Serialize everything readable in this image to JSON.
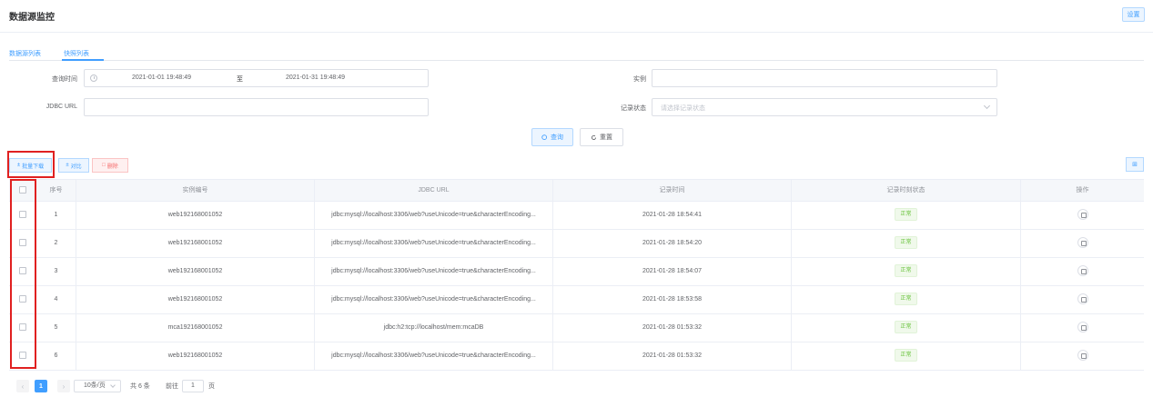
{
  "header": {
    "title": "数据源监控",
    "settings_label": "设置"
  },
  "tabs": [
    {
      "label": "数据源列表",
      "active": false
    },
    {
      "label": "快照列表",
      "active": true
    }
  ],
  "filters": {
    "query_time_label": "查询时间",
    "start_time": "2021-01-01 19:48:49",
    "range_separator": "至",
    "end_time": "2021-01-31 19:48:49",
    "instance_label": "实例",
    "instance_value": "",
    "jdbc_label": "JDBC URL",
    "jdbc_value": "",
    "status_label": "记录状态",
    "status_placeholder": "请选择记录状态"
  },
  "actions": {
    "query_label": "查询",
    "reset_label": "重置"
  },
  "toolbar": {
    "batch_download_label": "批量下载",
    "compare_label": "对比",
    "delete_label": "删除"
  },
  "table": {
    "columns": [
      "序号",
      "实例编号",
      "JDBC URL",
      "记录时间",
      "记录时刻状态",
      "操作"
    ],
    "rows": [
      {
        "index": "1",
        "instance": "web192168001052",
        "jdbc": "jdbc:mysql://localhost:3306/web?useUnicode=true&characterEncoding...",
        "time": "2021-01-28 18:54:41",
        "status": "正常"
      },
      {
        "index": "2",
        "instance": "web192168001052",
        "jdbc": "jdbc:mysql://localhost:3306/web?useUnicode=true&characterEncoding...",
        "time": "2021-01-28 18:54:20",
        "status": "正常"
      },
      {
        "index": "3",
        "instance": "web192168001052",
        "jdbc": "jdbc:mysql://localhost:3306/web?useUnicode=true&characterEncoding...",
        "time": "2021-01-28 18:54:07",
        "status": "正常"
      },
      {
        "index": "4",
        "instance": "web192168001052",
        "jdbc": "jdbc:mysql://localhost:3306/web?useUnicode=true&characterEncoding...",
        "time": "2021-01-28 18:53:58",
        "status": "正常"
      },
      {
        "index": "5",
        "instance": "mca192168001052",
        "jdbc": "jdbc:h2:tcp://localhost/mem:mcaDB",
        "time": "2021-01-28 01:53:32",
        "status": "正常"
      },
      {
        "index": "6",
        "instance": "web192168001052",
        "jdbc": "jdbc:mysql://localhost:3306/web?useUnicode=true&characterEncoding...",
        "time": "2021-01-28 01:53:32",
        "status": "正常"
      }
    ]
  },
  "pagination": {
    "current_page": "1",
    "page_size": "10条/页",
    "total": "共 6 条",
    "goto_label": "前往",
    "goto_value": "1",
    "goto_unit": "页"
  },
  "icons": {
    "clock": "clock-icon",
    "query": "search-icon",
    "reset": "refresh-icon",
    "download": "download-icon",
    "compare": "compare-icon",
    "delete": "trash-icon",
    "grid": "grid-icon",
    "operation": "camera-icon"
  },
  "colors": {
    "primary": "#409eff",
    "success": "#67c23a",
    "danger": "#f56c6c",
    "highlight_box": "#e02020"
  }
}
